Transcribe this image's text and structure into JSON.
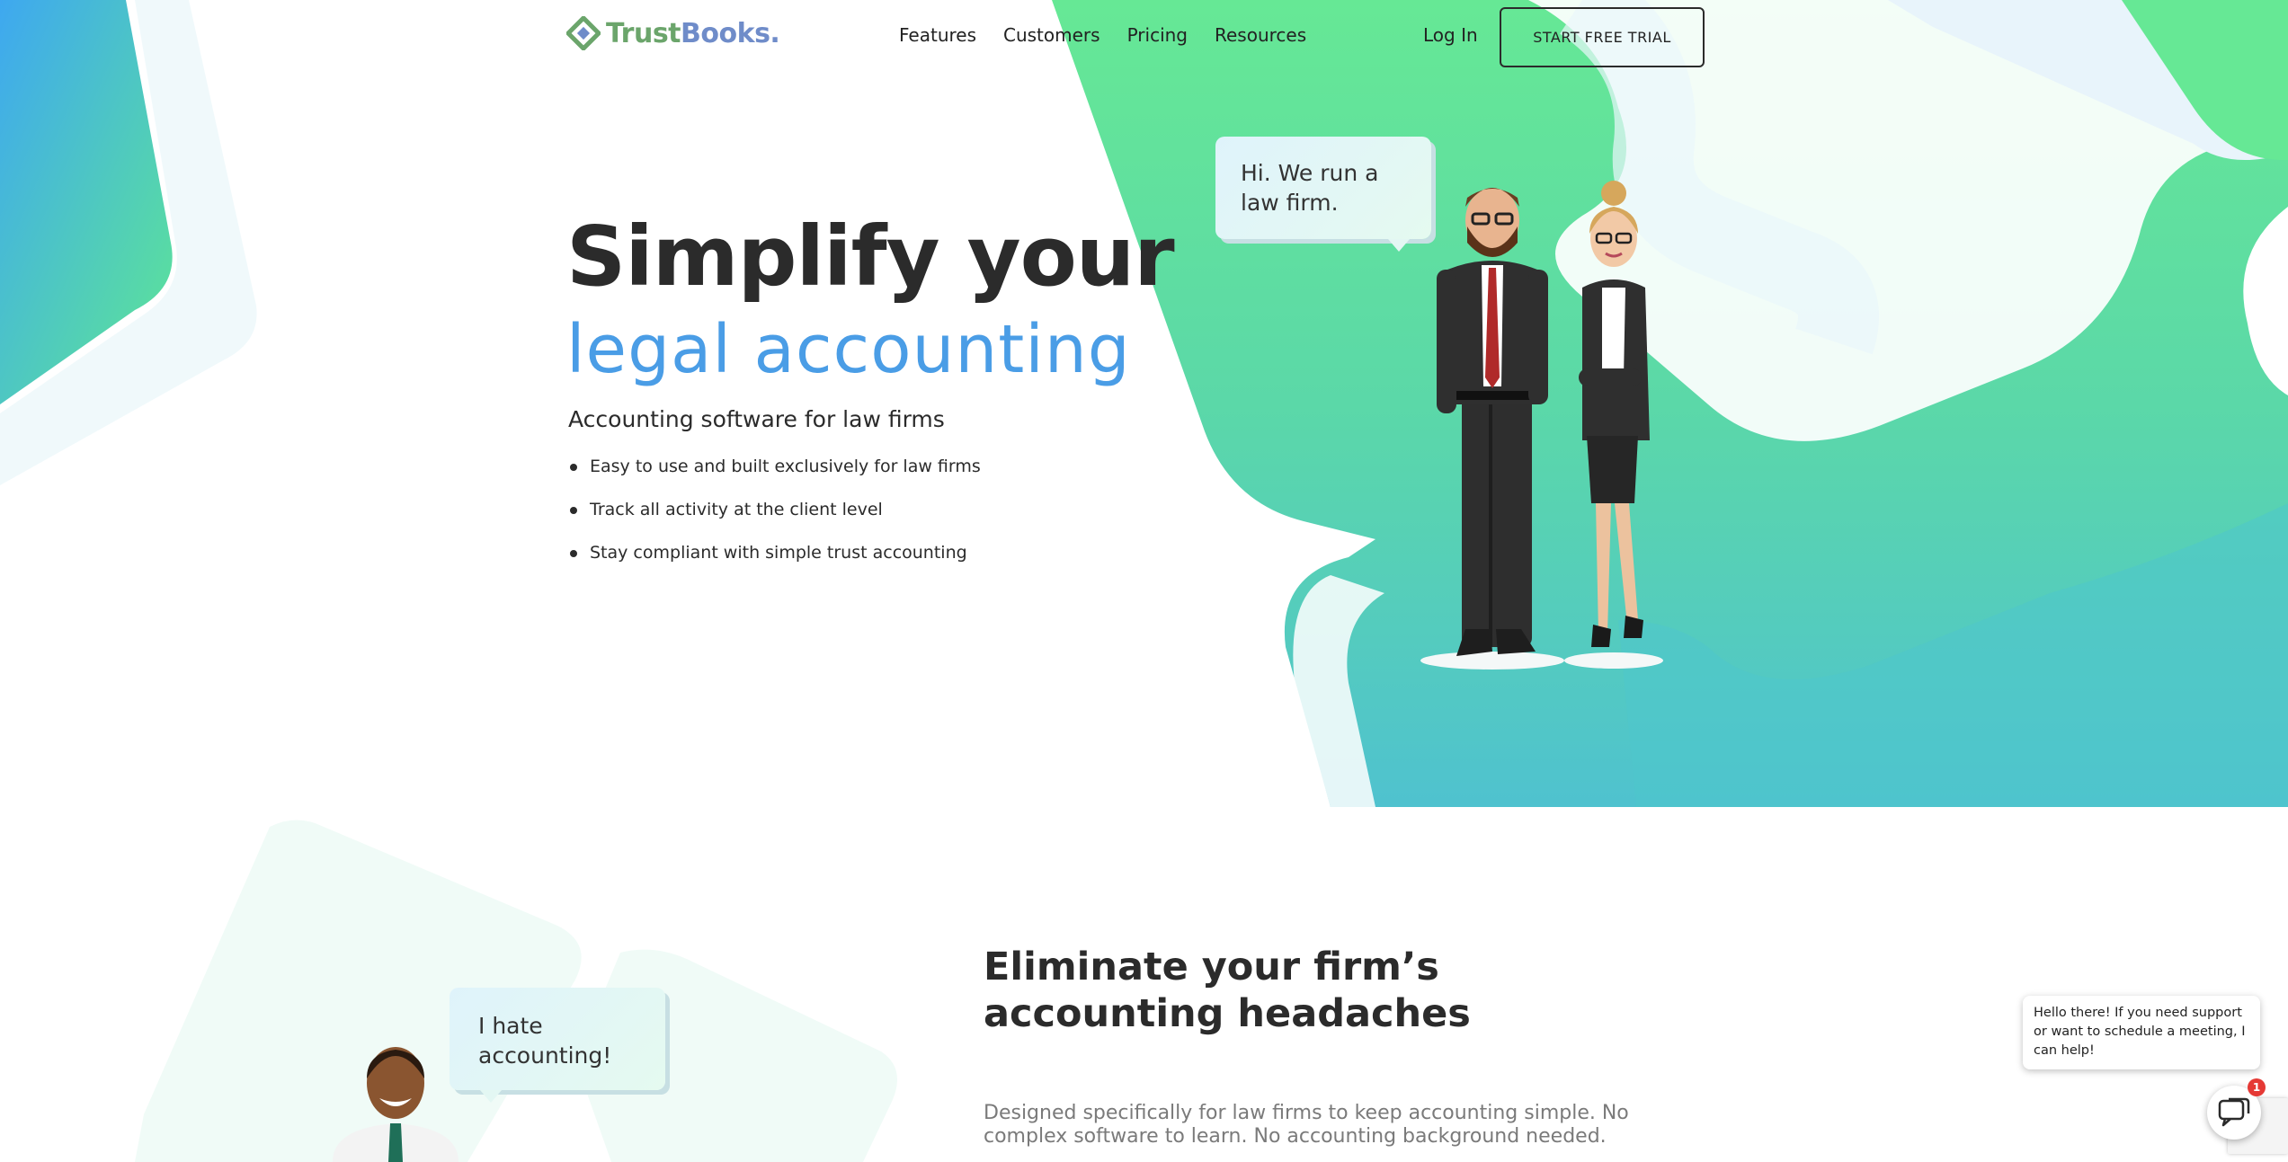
{
  "brand": {
    "name_part1": "Trust",
    "name_part2": "Books.",
    "colors": {
      "green": "#6ba56b",
      "blue": "#6f8cc9"
    }
  },
  "nav": {
    "items": [
      "Features",
      "Customers",
      "Pricing",
      "Resources"
    ],
    "login": "Log In",
    "cta": "START FREE TRIAL"
  },
  "hero": {
    "title_line1": "Simplify your",
    "title_line2": "legal accounting",
    "subtitle": "Accounting software for law firms",
    "bullets": [
      "Easy to use and built exclusively for law firms",
      "Track all activity at the client level",
      "Stay compliant with simple trust accounting"
    ],
    "bubble": [
      "Hi. We run a",
      "law firm."
    ]
  },
  "section2": {
    "title_line1": "Eliminate your firm’s",
    "title_line2": "accounting headaches",
    "text": "Designed specifically for law firms to keep accounting simple. No complex software to learn. No accounting background needed.",
    "bubble": [
      "I hate",
      "accounting!"
    ]
  },
  "chat": {
    "message": "Hello there!  If you need support or want to schedule a meeting, I can help!",
    "badge_count": "1",
    "icon": "chat-icon"
  },
  "colors": {
    "accent_blue": "#4a9de6",
    "green": "#5ee694",
    "teal": "#4fc2cf",
    "text_dark": "#2b2b2b"
  }
}
